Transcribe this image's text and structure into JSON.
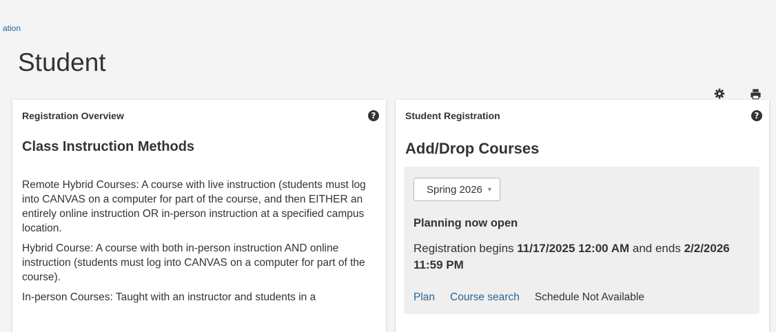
{
  "breadcrumb": {
    "label": "ation"
  },
  "page": {
    "title": "Student"
  },
  "header_icons": [
    "gear-icon",
    "print-icon"
  ],
  "left_card": {
    "title": "Registration Overview",
    "help_glyph": "?",
    "heading": "Class Instruction Methods",
    "paragraphs": [
      "Remote Hybrid Courses: A course with live instruction (students must log into CANVAS on a computer for part of the course, and then EITHER an entirely online instruction OR in-person instruction at a specified campus location.",
      "Hybrid Course: A course with both in-person instruction AND online instruction (students must log into CANVAS on a computer for part of the course).",
      "In-person Courses: Taught with an instructor and students in a"
    ]
  },
  "right_card": {
    "title": "Student Registration",
    "help_glyph": "?",
    "heading": "Add/Drop Courses",
    "term_select": {
      "value": "Spring 2026"
    },
    "status": "Planning now open",
    "registration": {
      "prefix": "Registration begins ",
      "begins": "11/17/2025 12:00 AM",
      "middle": " and ends ",
      "ends": "2/2/2026 11:59 PM"
    },
    "links": {
      "plan": "Plan",
      "course_search": "Course search",
      "schedule": "Schedule Not Available"
    }
  },
  "colors": {
    "link": "#2a6496",
    "page_bg": "#f4f4f4",
    "panel_bg": "#efefef",
    "text": "#333333"
  }
}
